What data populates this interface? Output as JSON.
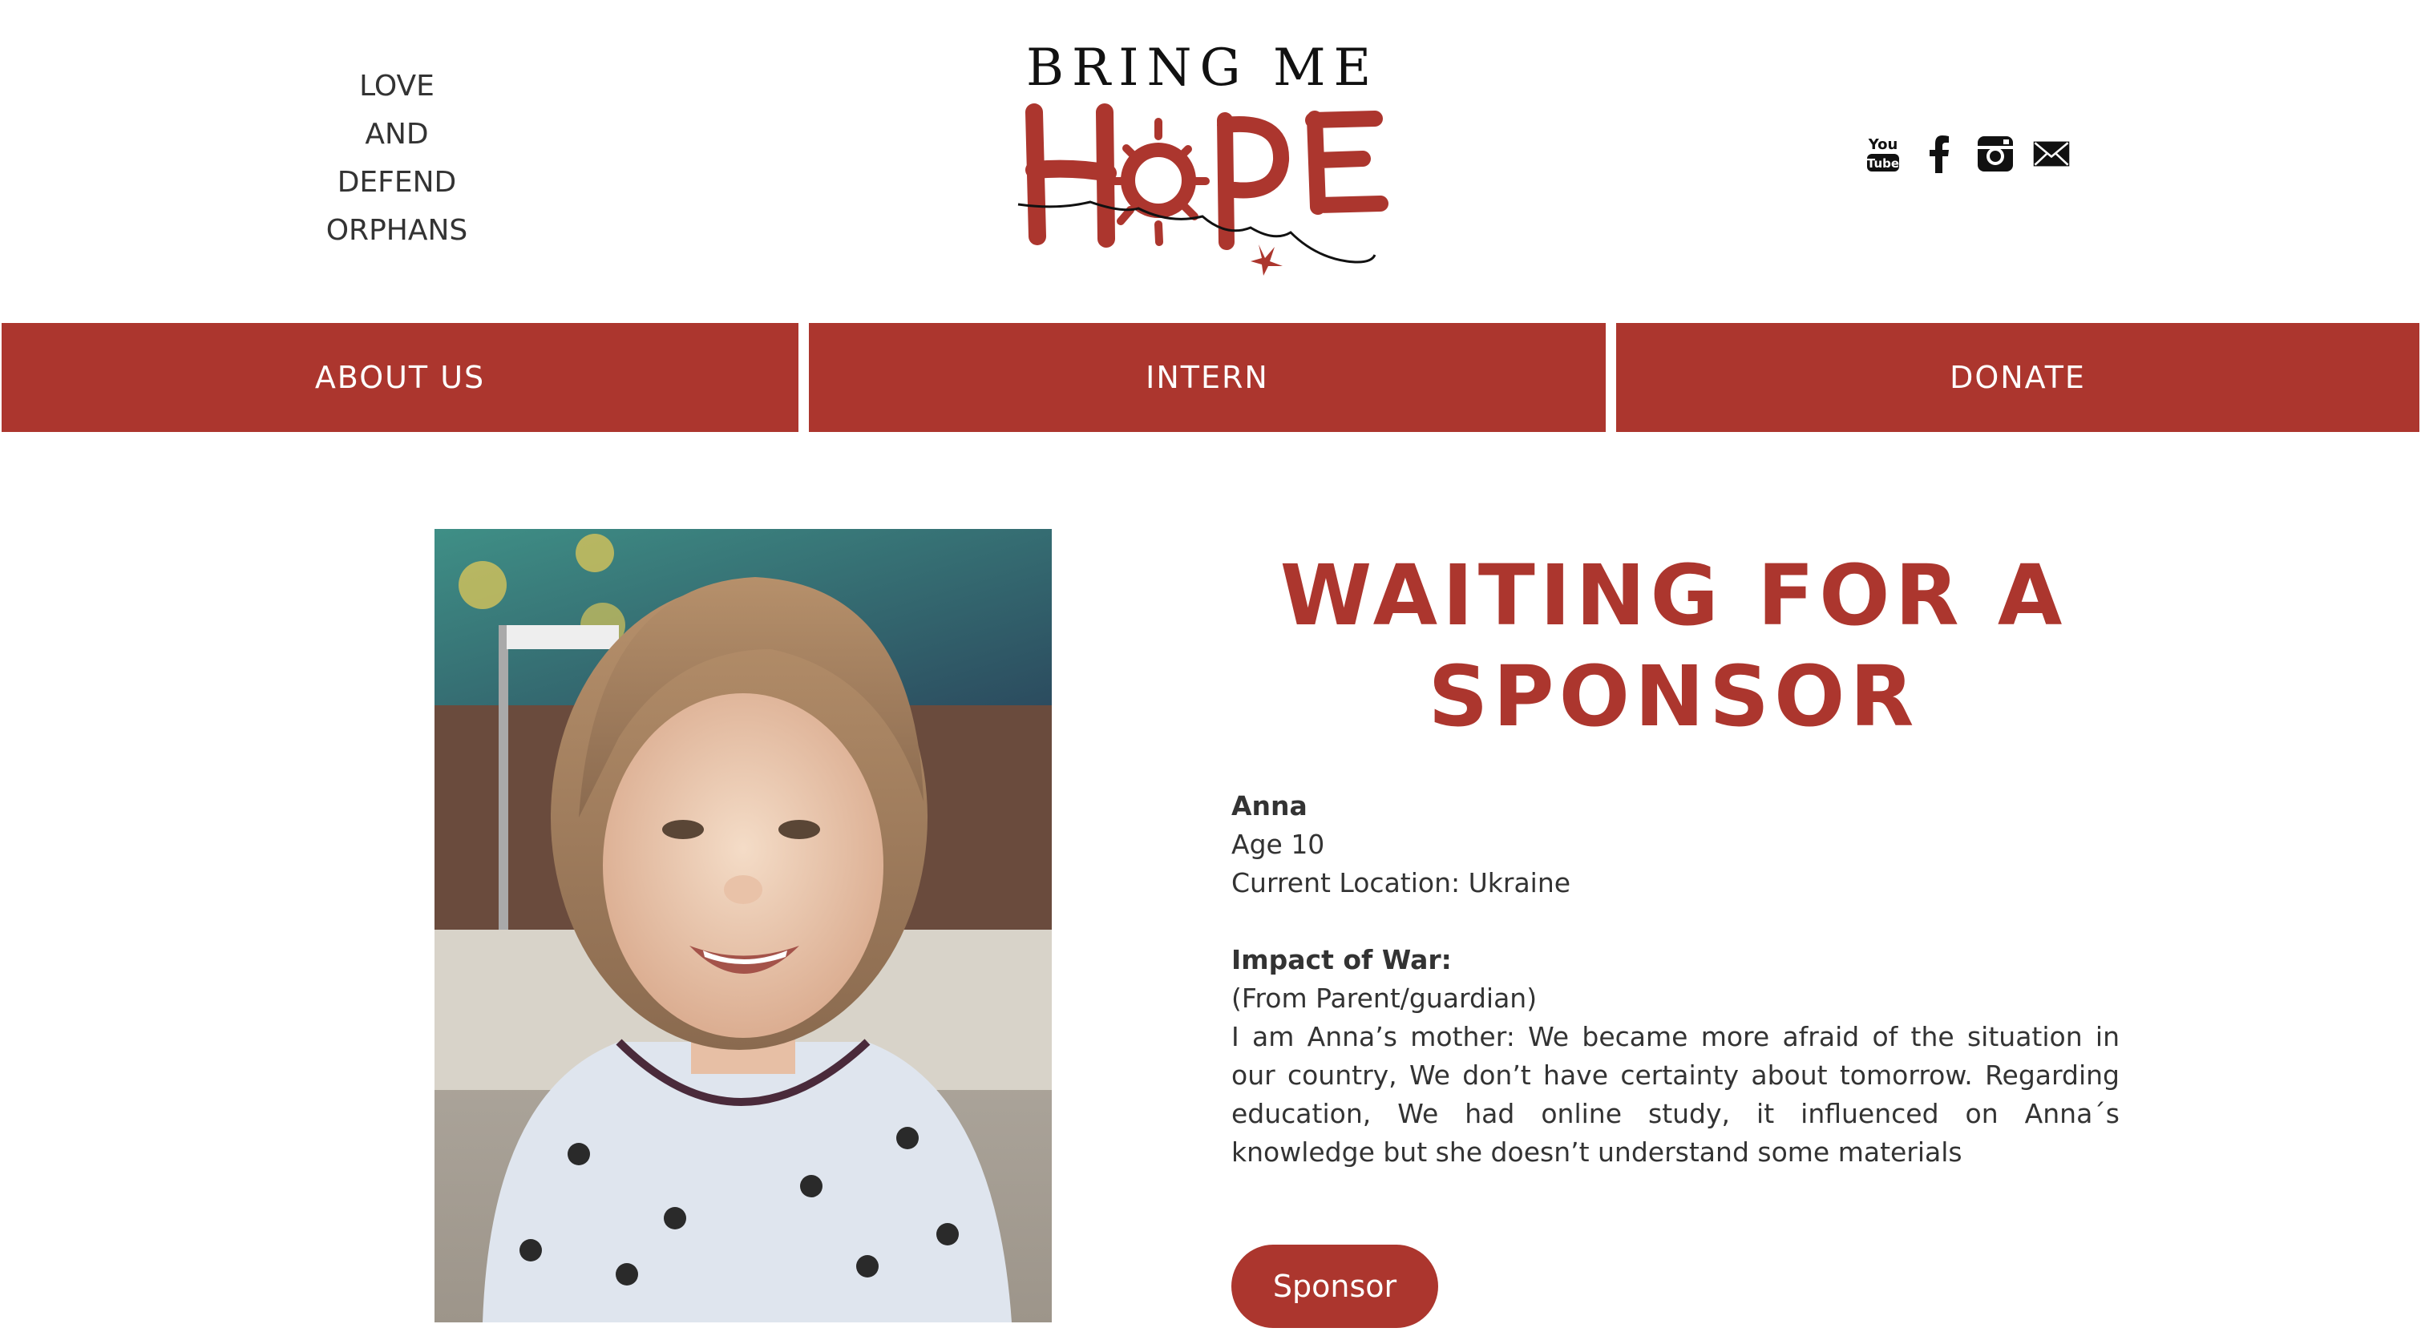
{
  "header": {
    "tagline": [
      "LOVE",
      "AND",
      "DEFEND",
      "ORPHANS"
    ],
    "logo": {
      "line1": "BRING ME",
      "line2": "HOPE"
    },
    "social": [
      "youtube-icon",
      "facebook-icon",
      "instagram-icon",
      "mail-icon"
    ]
  },
  "nav": {
    "items": [
      {
        "label": "ABOUT US"
      },
      {
        "label": "INTERN"
      },
      {
        "label": "DONATE"
      }
    ]
  },
  "main": {
    "heading_line1": "WAITING FOR A",
    "heading_line2": "SPONSOR",
    "child": {
      "name": "Anna",
      "age": "Age 10",
      "location": "Current Location: Ukraine"
    },
    "impact": {
      "title": "Impact of War:",
      "source": "(From Parent/guardian)",
      "text": "I am Anna’s mother: We became more afraid of the situation in our country, We don’t have certainty about tomorrow. Regarding education, We had online study, it influenced on Anna´s knowledge but she doesn’t understand some materials"
    },
    "sponsor_label": "Sponsor"
  },
  "colors": {
    "brand_red": "#ac362e",
    "text": "#333333"
  }
}
